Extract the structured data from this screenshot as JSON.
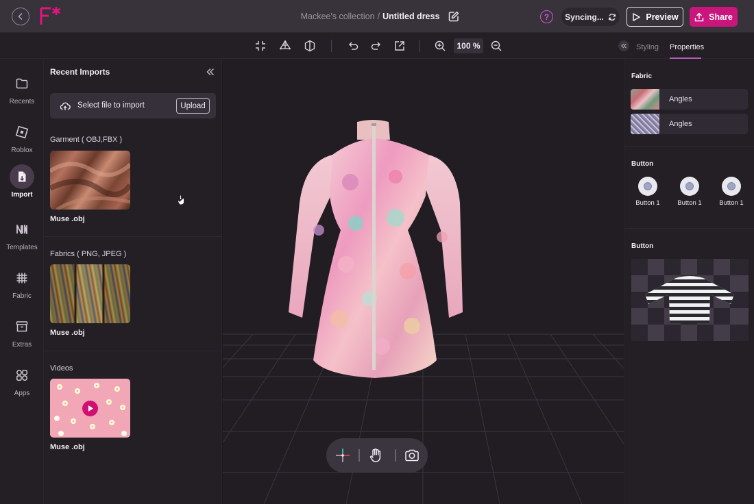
{
  "header": {
    "collection": "Mackee's collection",
    "separator": "/",
    "title": "Untitled dress",
    "help": "?",
    "sync_label": "Syncing...",
    "preview_label": "Preview",
    "share_label": "Share",
    "accent_color": "#c9157c"
  },
  "toolbar": {
    "zoom": "100 %",
    "tabs": [
      {
        "label": "Styling",
        "active": false
      },
      {
        "label": "Properties",
        "active": true
      }
    ]
  },
  "rail": {
    "items": [
      {
        "label": "Recents",
        "icon": "folder-icon"
      },
      {
        "label": "Roblox",
        "icon": "roblox-icon"
      },
      {
        "label": "Import",
        "icon": "import-file-icon",
        "active": true
      },
      {
        "label": "Templates",
        "icon": "templates-icon"
      },
      {
        "label": "Fabric",
        "icon": "fabric-icon"
      },
      {
        "label": "Extras",
        "icon": "extras-box-icon"
      },
      {
        "label": "Apps",
        "icon": "apps-grid-icon"
      }
    ]
  },
  "imports": {
    "title": "Recent Imports",
    "select_label": "Select file to import",
    "upload_label": "Upload",
    "sections": [
      {
        "title": "Garment ( OBJ,FBX )",
        "file": "Muse .obj"
      },
      {
        "title": "Fabrics  ( PNG, JPEG )",
        "file": "Muse .obj"
      },
      {
        "title": "Videos",
        "file": "Muse .obj"
      }
    ]
  },
  "properties": {
    "fabric_title": "Fabric",
    "fabrics": [
      {
        "name": "Angles"
      },
      {
        "name": "Angles"
      }
    ],
    "button_title": "Button",
    "buttons": [
      {
        "label": "Button 1"
      },
      {
        "label": "Button 1"
      },
      {
        "label": "Button 1"
      }
    ],
    "button_title_2": "Button"
  }
}
